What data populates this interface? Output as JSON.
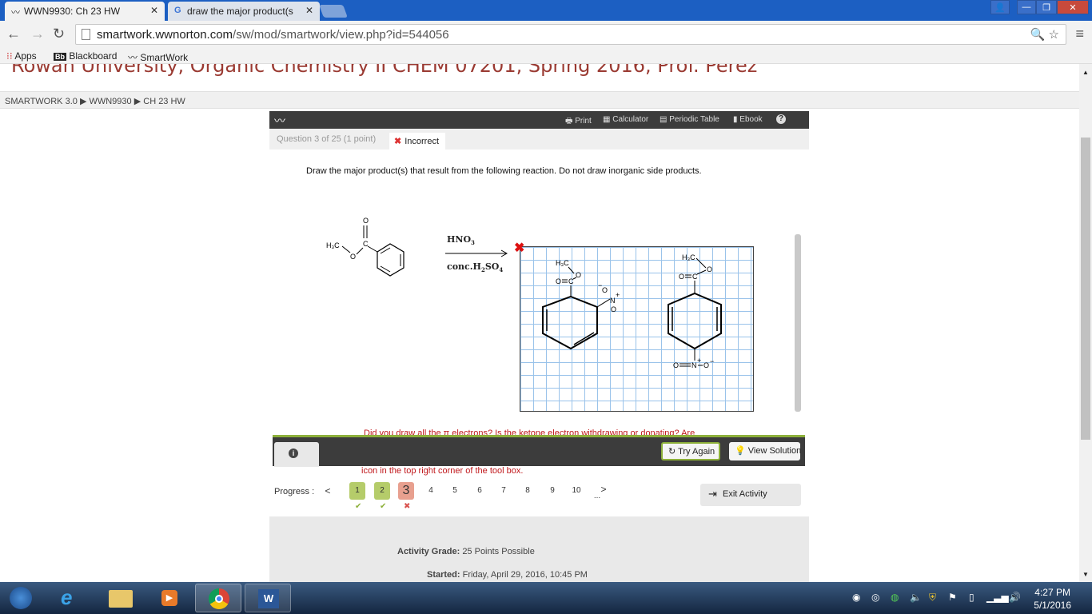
{
  "browser": {
    "tabs": [
      {
        "label": "WWN9930: Ch 23 HW",
        "icon": "wwnorton-bird-icon"
      },
      {
        "label": "draw the major product(s",
        "icon": "google-g-icon"
      }
    ],
    "url_host": "smartwork.wwnorton.com",
    "url_path": "/sw/mod/smartwork/view.php?id=544056",
    "bookmarks": [
      {
        "label": "Apps",
        "icon": "apps-grid-icon"
      },
      {
        "label": "Blackboard",
        "icon": "blackboard-bb-icon"
      },
      {
        "label": "SmartWork",
        "icon": "wwnorton-bird-icon"
      }
    ]
  },
  "course_title": "Rowan University, Organic Chemistry II CHEM 07201, Spring 2016, Prof. Perez",
  "breadcrumb": [
    "SMARTWORK 3.0",
    "WWN9930",
    "CH 23 HW"
  ],
  "toolbar": {
    "print": "Print",
    "calculator": "Calculator",
    "periodic_table": "Periodic Table",
    "ebook": "Ebook",
    "help": "?"
  },
  "question": {
    "number_label": "Question 3 of 25 (1 point)",
    "status": "Incorrect",
    "prompt": "Draw the major product(s) that result from the following reaction. Do not draw inorganic side products.",
    "reagent_top": {
      "main": "HNO",
      "sub": "3"
    },
    "reagent_bottom": {
      "pre": "conc.H",
      "sub1": "2",
      "mid": "SO",
      "sub2": "4"
    },
    "reactant_labels": {
      "o": "O",
      "c": "C",
      "h3c": "H₃C",
      "o_ester": "O"
    },
    "product_labels": {
      "h3c": "H₃C",
      "o": "O",
      "c": "C",
      "nplus": "N",
      "plus": "+",
      "minus": "−",
      "ominus": "O"
    },
    "feedback_1": "Did you draw all the π electrons? Is the ketone electron withdrawing or donating? Are one or two products formed?",
    "feedback_2": "Between attempts try reseting the drawing module by clicking on the red double arrow icon in the top right corner of the tool box."
  },
  "actions": {
    "try_again": "Try Again",
    "view_solution": "View Solution",
    "info": "i"
  },
  "progress": {
    "label": "Progress :",
    "prev": "<",
    "next": ">",
    "ellipsis": "...",
    "pages": [
      "1",
      "2",
      "3",
      "4",
      "5",
      "6",
      "7",
      "8",
      "9",
      "10"
    ],
    "current": 3,
    "statuses": [
      {
        "mark": "✔",
        "color": "#8db03a"
      },
      {
        "mark": "✔",
        "color": "#8db03a"
      },
      {
        "mark": "✖",
        "color": "#d9534f"
      }
    ],
    "exit": "Exit Activity"
  },
  "footer": {
    "grade_label": "Activity Grade:",
    "grade_value": "25 Points Possible",
    "started_label": "Started:",
    "started_value": "Friday, April 29, 2016, 10:45 PM"
  },
  "taskbar": {
    "time": "4:27 PM",
    "date": "5/1/2016"
  },
  "colors": {
    "course_title": "#9a3a32",
    "feedback": "#c0171b",
    "accent_green": "#8db03a",
    "current_page": "#e8a08f",
    "done_page": "#b5cc6a"
  }
}
